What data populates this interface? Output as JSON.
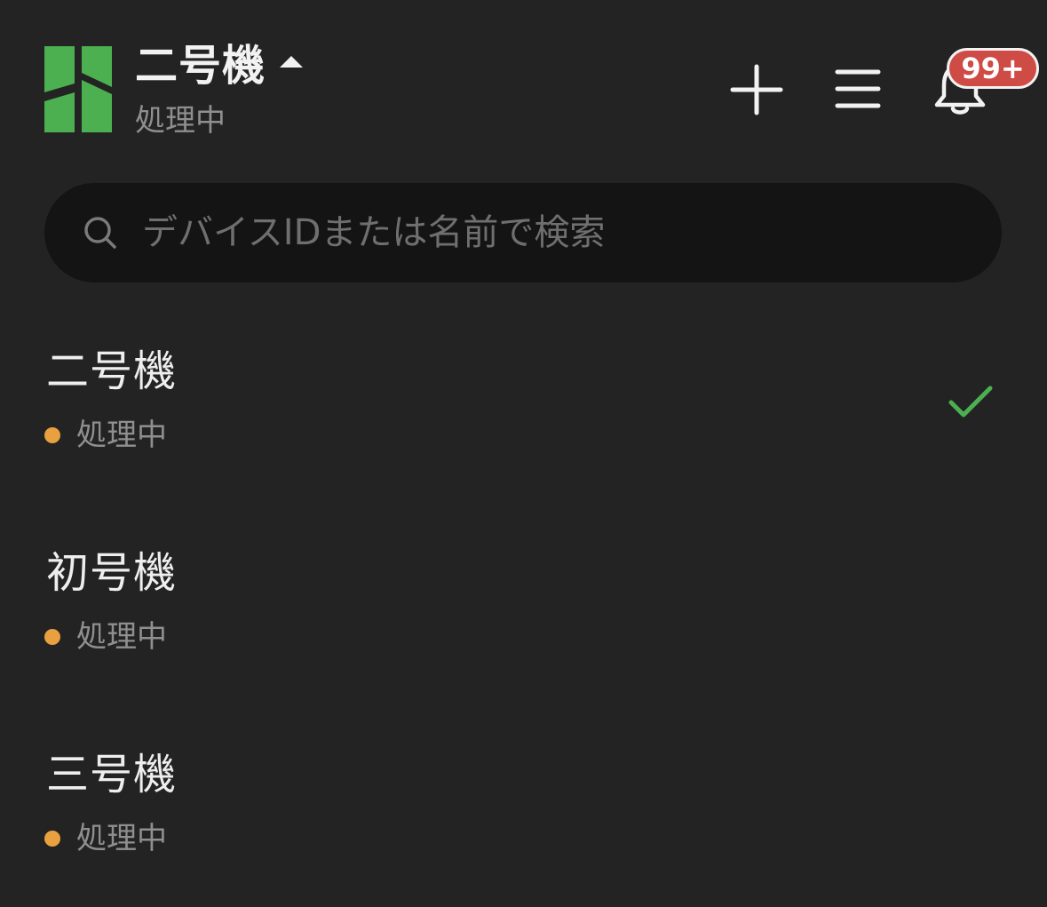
{
  "header": {
    "title": "二号機",
    "status": "処理中",
    "notification_badge": "99+"
  },
  "search": {
    "placeholder": "デバイスIDまたは名前で検索"
  },
  "devices": [
    {
      "name": "二号機",
      "status": "処理中",
      "selected": true
    },
    {
      "name": "初号機",
      "status": "処理中",
      "selected": false
    },
    {
      "name": "三号機",
      "status": "処理中",
      "selected": false
    }
  ],
  "colors": {
    "background": "#232323",
    "brand_green": "#4caf50",
    "status_processing": "#e8a040",
    "badge_red": "#cf4b45",
    "check_green": "#4caf50"
  },
  "icons": [
    "app-logo",
    "caret-up-icon",
    "plus-icon",
    "menu-icon",
    "bell-icon",
    "search-icon",
    "check-icon"
  ]
}
